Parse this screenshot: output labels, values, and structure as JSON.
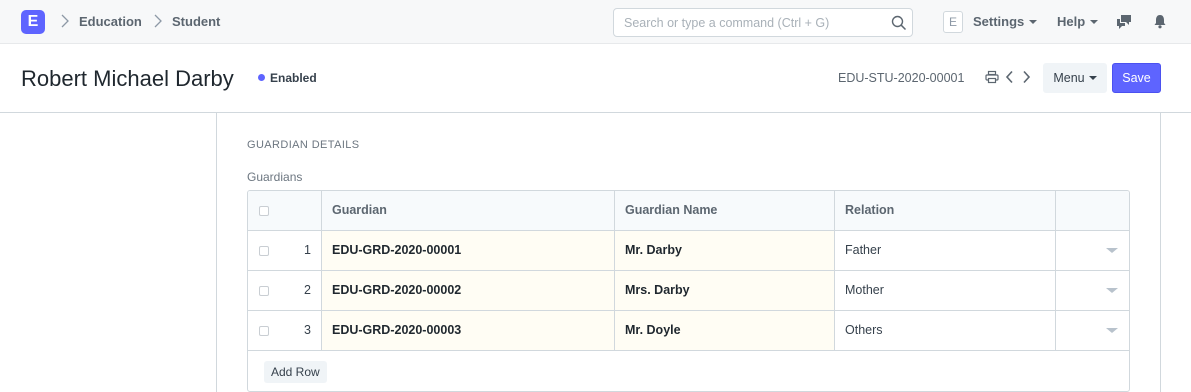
{
  "navbar": {
    "logo_letter": "E",
    "breadcrumbs": [
      {
        "label": "Education"
      },
      {
        "label": "Student"
      }
    ],
    "search_placeholder": "Search or type a command (Ctrl + G)",
    "user_badge": "E",
    "settings_label": "Settings",
    "help_label": "Help",
    "icons": [
      "search-icon",
      "chat-icon",
      "bell-icon"
    ]
  },
  "page_head": {
    "title": "Robert Michael Darby",
    "status": "Enabled",
    "status_color": "#5e64ff",
    "doc_name": "EDU-STU-2020-00001",
    "menu_label": "Menu",
    "save_label": "Save",
    "accent": "#5e64ff"
  },
  "section": {
    "title": "GUARDIAN DETAILS",
    "field_label": "Guardians"
  },
  "grid": {
    "columns": [
      "Guardian",
      "Guardian Name",
      "Relation"
    ],
    "rows": [
      {
        "idx": "1",
        "guardian": "EDU-GRD-2020-00001",
        "guardian_name": "Mr. Darby",
        "relation": "Father"
      },
      {
        "idx": "2",
        "guardian": "EDU-GRD-2020-00002",
        "guardian_name": "Mrs. Darby",
        "relation": "Mother"
      },
      {
        "idx": "3",
        "guardian": "EDU-GRD-2020-00003",
        "guardian_name": "Mr. Doyle",
        "relation": "Others"
      }
    ],
    "add_row_label": "Add Row"
  }
}
